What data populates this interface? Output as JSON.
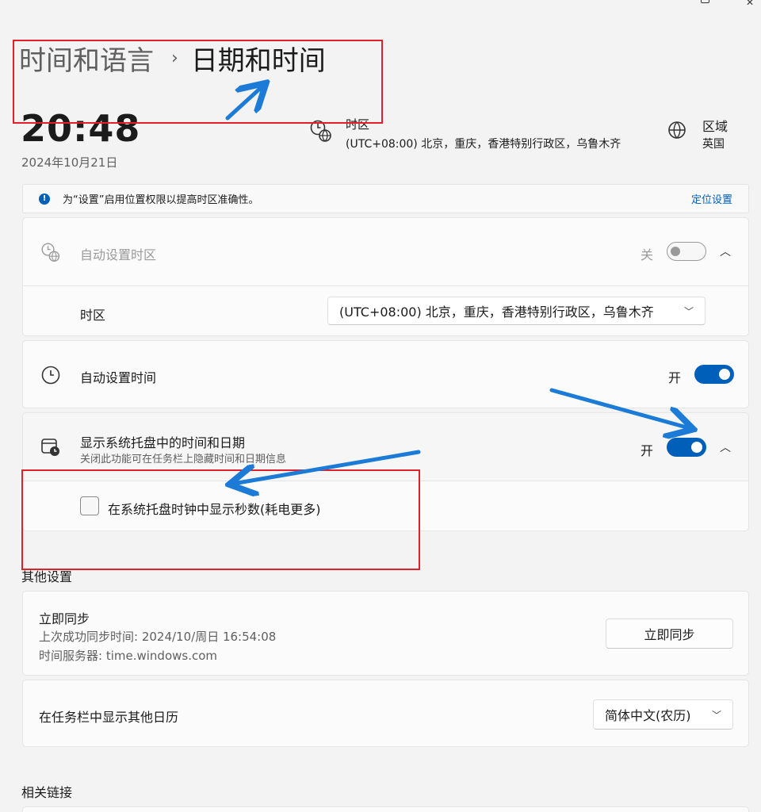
{
  "breadcrumb": {
    "parent": "时间和语言",
    "separator": "›",
    "current": "日期和时间"
  },
  "clock": {
    "time": "20:48",
    "date": "2024年10月21日"
  },
  "timezone_summary": {
    "title": "时区",
    "value": "(UTC+08:00) 北京，重庆，香港特别行政区，乌鲁木齐"
  },
  "region_summary": {
    "title": "区域",
    "value": "英国"
  },
  "info_bar": {
    "text": "为“设置”启用位置权限以提高时区准确性。",
    "link": "定位设置"
  },
  "auto_timezone": {
    "label": "自动设置时区",
    "state_text": "关",
    "timezone_label": "时区",
    "timezone_value": "(UTC+08:00) 北京，重庆，香港特别行政区，乌鲁木齐"
  },
  "auto_time": {
    "label": "自动设置时间",
    "state_text": "开"
  },
  "tray_time": {
    "label": "显示系统托盘中的时间和日期",
    "sublabel": "关闭此功能可在任务栏上隐藏时间和日期信息",
    "state_text": "开",
    "seconds_checkbox_label": "在系统托盘时钟中显示秒数(耗电更多)"
  },
  "other_settings": {
    "title": "其他设置",
    "sync": {
      "label": "立即同步",
      "last_sync": "上次成功同步时间: 2024/10/周日 16:54:08",
      "server": "时间服务器: time.windows.com",
      "button": "立即同步"
    },
    "calendar": {
      "label": "在任务栏中显示其他日历",
      "value": "简体中文(农历)"
    }
  },
  "related_links": {
    "title": "相关链接"
  },
  "colors": {
    "accent": "#005fb8",
    "annotation_box": "#e0202a",
    "annotation_arrow": "#1c7bd6"
  }
}
